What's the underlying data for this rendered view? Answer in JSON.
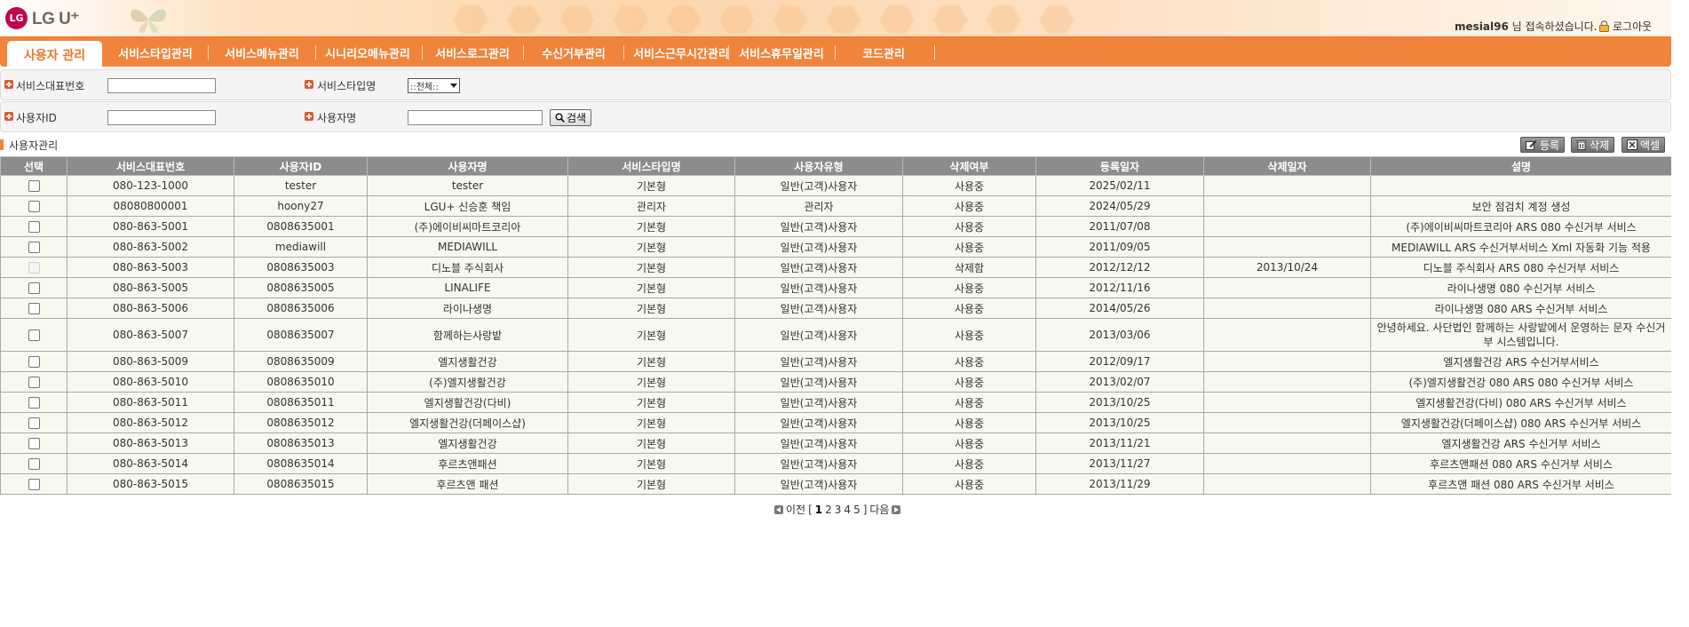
{
  "header": {
    "logo_text": "LG U⁺",
    "logo_mark": "LG",
    "user_id": "mesial96",
    "welcome_suffix": " 님 접속하셨습니다.",
    "logout_label": "로그아웃",
    "lock_icon": "lock-icon"
  },
  "nav": {
    "items": [
      {
        "label": "사용자 관리",
        "active": true
      },
      {
        "label": "서비스타입관리",
        "active": false
      },
      {
        "label": "서비스메뉴관리",
        "active": false
      },
      {
        "label": "시니리오메뉴관리",
        "active": false
      },
      {
        "label": "서비스로그관리",
        "active": false
      },
      {
        "label": "수신거부관리",
        "active": false
      },
      {
        "label": "서비스근무시간관리",
        "active": false
      },
      {
        "label": "서비스휴무일관리",
        "active": false
      },
      {
        "label": "코드관리",
        "active": false
      }
    ],
    "accent_color": "#f0843a"
  },
  "search": {
    "service_number_label": "서비스대표번호",
    "service_number_value": "",
    "service_type_label": "서비스타입명",
    "service_type_selected": "::전체::",
    "user_id_label": "사용자ID",
    "user_id_value": "",
    "user_name_label": "사용자명",
    "user_name_value": "",
    "search_button_label": "검색"
  },
  "section": {
    "title": "사용자관리",
    "register_label": "등록",
    "delete_label": "삭제",
    "excel_label": "엑셀"
  },
  "table": {
    "columns": [
      "선택",
      "서비스대표번호",
      "사용자ID",
      "사용자명",
      "서비스타입명",
      "사용자유형",
      "삭제여부",
      "등록일자",
      "삭제일자",
      "설명"
    ],
    "rows": [
      {
        "number": "080-123-1000",
        "user_id": "tester",
        "name": "tester",
        "type": "기본형",
        "user_type": "일반(고객)사용자",
        "status": "사용중",
        "reg_date": "2025/02/11",
        "del_date": "",
        "desc": "",
        "disabled": false
      },
      {
        "number": "08080800001",
        "user_id": "hoony27",
        "name": "LGU+ 신승훈 책임",
        "type": "관리자",
        "user_type": "관리자",
        "status": "사용중",
        "reg_date": "2024/05/29",
        "del_date": "",
        "desc": "보안 점검치 계정 생성",
        "disabled": false
      },
      {
        "number": "080-863-5001",
        "user_id": "0808635001",
        "name": "(주)에이비씨마트코리아",
        "type": "기본형",
        "user_type": "일반(고객)사용자",
        "status": "사용중",
        "reg_date": "2011/07/08",
        "del_date": "",
        "desc": "(주)에이비씨마트코리아 ARS 080 수신거부 서비스",
        "disabled": false
      },
      {
        "number": "080-863-5002",
        "user_id": "mediawill",
        "name": "MEDIAWILL",
        "type": "기본형",
        "user_type": "일반(고객)사용자",
        "status": "사용중",
        "reg_date": "2011/09/05",
        "del_date": "",
        "desc": "MEDIAWILL ARS 수신거부서비스 Xml 자동화 기능 적용",
        "disabled": false
      },
      {
        "number": "080-863-5003",
        "user_id": "0808635003",
        "name": "디노블 주식회사",
        "type": "기본형",
        "user_type": "일반(고객)사용자",
        "status": "삭제함",
        "reg_date": "2012/12/12",
        "del_date": "2013/10/24",
        "desc": "디노블 주식회사 ARS 080 수신거부 서비스",
        "disabled": true
      },
      {
        "number": "080-863-5005",
        "user_id": "0808635005",
        "name": "LINALIFE",
        "type": "기본형",
        "user_type": "일반(고객)사용자",
        "status": "사용중",
        "reg_date": "2012/11/16",
        "del_date": "",
        "desc": "라이나생명 080 수신거부 서비스",
        "disabled": false
      },
      {
        "number": "080-863-5006",
        "user_id": "0808635006",
        "name": "라이나생명",
        "type": "기본형",
        "user_type": "일반(고객)사용자",
        "status": "사용중",
        "reg_date": "2014/05/26",
        "del_date": "",
        "desc": "라이나생명 080 ARS 수신거부 서비스",
        "disabled": false
      },
      {
        "number": "080-863-5007",
        "user_id": "0808635007",
        "name": "함께하는사랑밭",
        "type": "기본형",
        "user_type": "일반(고객)사용자",
        "status": "사용중",
        "reg_date": "2013/03/06",
        "del_date": "",
        "desc": "안녕하세요. 사단법인 함께하는 사랑밭에서 운영하는 문자 수신거부 시스템입니다.",
        "disabled": false,
        "tall": true
      },
      {
        "number": "080-863-5009",
        "user_id": "0808635009",
        "name": "엘지생활건강",
        "type": "기본형",
        "user_type": "일반(고객)사용자",
        "status": "사용중",
        "reg_date": "2012/09/17",
        "del_date": "",
        "desc": "엘지생활건강 ARS 수신거부서비스",
        "disabled": false
      },
      {
        "number": "080-863-5010",
        "user_id": "0808635010",
        "name": "(주)엘지생활건강",
        "type": "기본형",
        "user_type": "일반(고객)사용자",
        "status": "사용중",
        "reg_date": "2013/02/07",
        "del_date": "",
        "desc": "(주)엘지생활건강 080 ARS 080 수신거부 서비스",
        "disabled": false
      },
      {
        "number": "080-863-5011",
        "user_id": "0808635011",
        "name": "엘지생활건강(다비)",
        "type": "기본형",
        "user_type": "일반(고객)사용자",
        "status": "사용중",
        "reg_date": "2013/10/25",
        "del_date": "",
        "desc": "엘지생활건강(다비) 080 ARS 수신거부 서비스",
        "disabled": false
      },
      {
        "number": "080-863-5012",
        "user_id": "0808635012",
        "name": "엘지생활건강(더페이스샵)",
        "type": "기본형",
        "user_type": "일반(고객)사용자",
        "status": "사용중",
        "reg_date": "2013/10/25",
        "del_date": "",
        "desc": "엘지생활건강(더페이스샵) 080 ARS 수신거부 서비스",
        "disabled": false
      },
      {
        "number": "080-863-5013",
        "user_id": "0808635013",
        "name": "엘지생활건강",
        "type": "기본형",
        "user_type": "일반(고객)사용자",
        "status": "사용중",
        "reg_date": "2013/11/21",
        "del_date": "",
        "desc": "엘지생활건강 ARS 수신거부 서비스",
        "disabled": false
      },
      {
        "number": "080-863-5014",
        "user_id": "0808635014",
        "name": "후르츠앤패션",
        "type": "기본형",
        "user_type": "일반(고객)사용자",
        "status": "사용중",
        "reg_date": "2013/11/27",
        "del_date": "",
        "desc": "후르츠앤패션 080 ARS 수신거부 서비스",
        "disabled": false
      },
      {
        "number": "080-863-5015",
        "user_id": "0808635015",
        "name": "후르츠앤 패션",
        "type": "기본형",
        "user_type": "일반(고객)사용자",
        "status": "사용중",
        "reg_date": "2013/11/29",
        "del_date": "",
        "desc": "후르츠앤 패션 080 ARS 수신거부 서비스",
        "disabled": false
      }
    ]
  },
  "pager": {
    "prev_label": "이전",
    "next_label": "다음",
    "open_bracket": "[",
    "close_bracket": "]",
    "pages": [
      "1",
      "2",
      "3",
      "4",
      "5"
    ],
    "current": "1"
  }
}
